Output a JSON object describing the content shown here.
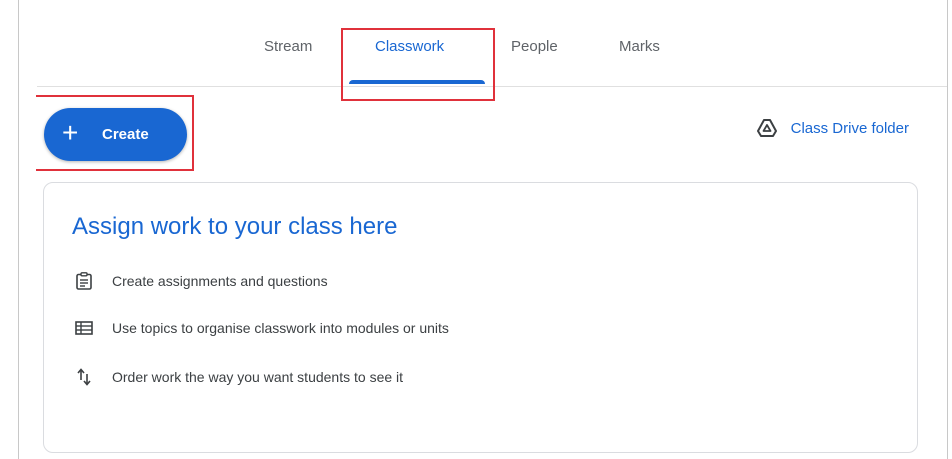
{
  "tabs": [
    {
      "label": "Stream"
    },
    {
      "label": "Classwork"
    },
    {
      "label": "People"
    },
    {
      "label": "Marks"
    }
  ],
  "active_tab": "Classwork",
  "create_button": {
    "label": "Create",
    "icon": "plus-icon"
  },
  "drive_link": {
    "label": "Class Drive folder",
    "icon": "drive-icon"
  },
  "empty_state": {
    "title": "Assign work to your class here",
    "items": [
      {
        "icon": "assignment-icon",
        "text": "Create assignments and questions"
      },
      {
        "icon": "topics-icon",
        "text": "Use topics to organise classwork into modules or units"
      },
      {
        "icon": "reorder-icon",
        "text": "Order work the way you want students to see it"
      }
    ]
  },
  "colors": {
    "accent": "#1967d2",
    "highlight": "#e0313b",
    "text": "#3c4043"
  }
}
